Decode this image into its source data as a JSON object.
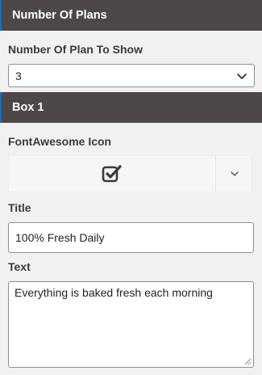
{
  "sections": {
    "plans_header": "Number Of Plans",
    "box1_header": "Box 1"
  },
  "plans_to_show": {
    "label": "Number Of Plan To Show",
    "selected": "3"
  },
  "box1": {
    "icon": {
      "label": "FontAwesome Icon",
      "selected_icon": "check-square-icon"
    },
    "title": {
      "label": "Title",
      "value": "100% Fresh Daily"
    },
    "text": {
      "label": "Text",
      "value": "Everything is baked fresh each morning"
    }
  },
  "colors": {
    "header_bg": "#4d4847",
    "header_accent": "#0b73c7",
    "panel_bg": "#f1f1f1"
  }
}
